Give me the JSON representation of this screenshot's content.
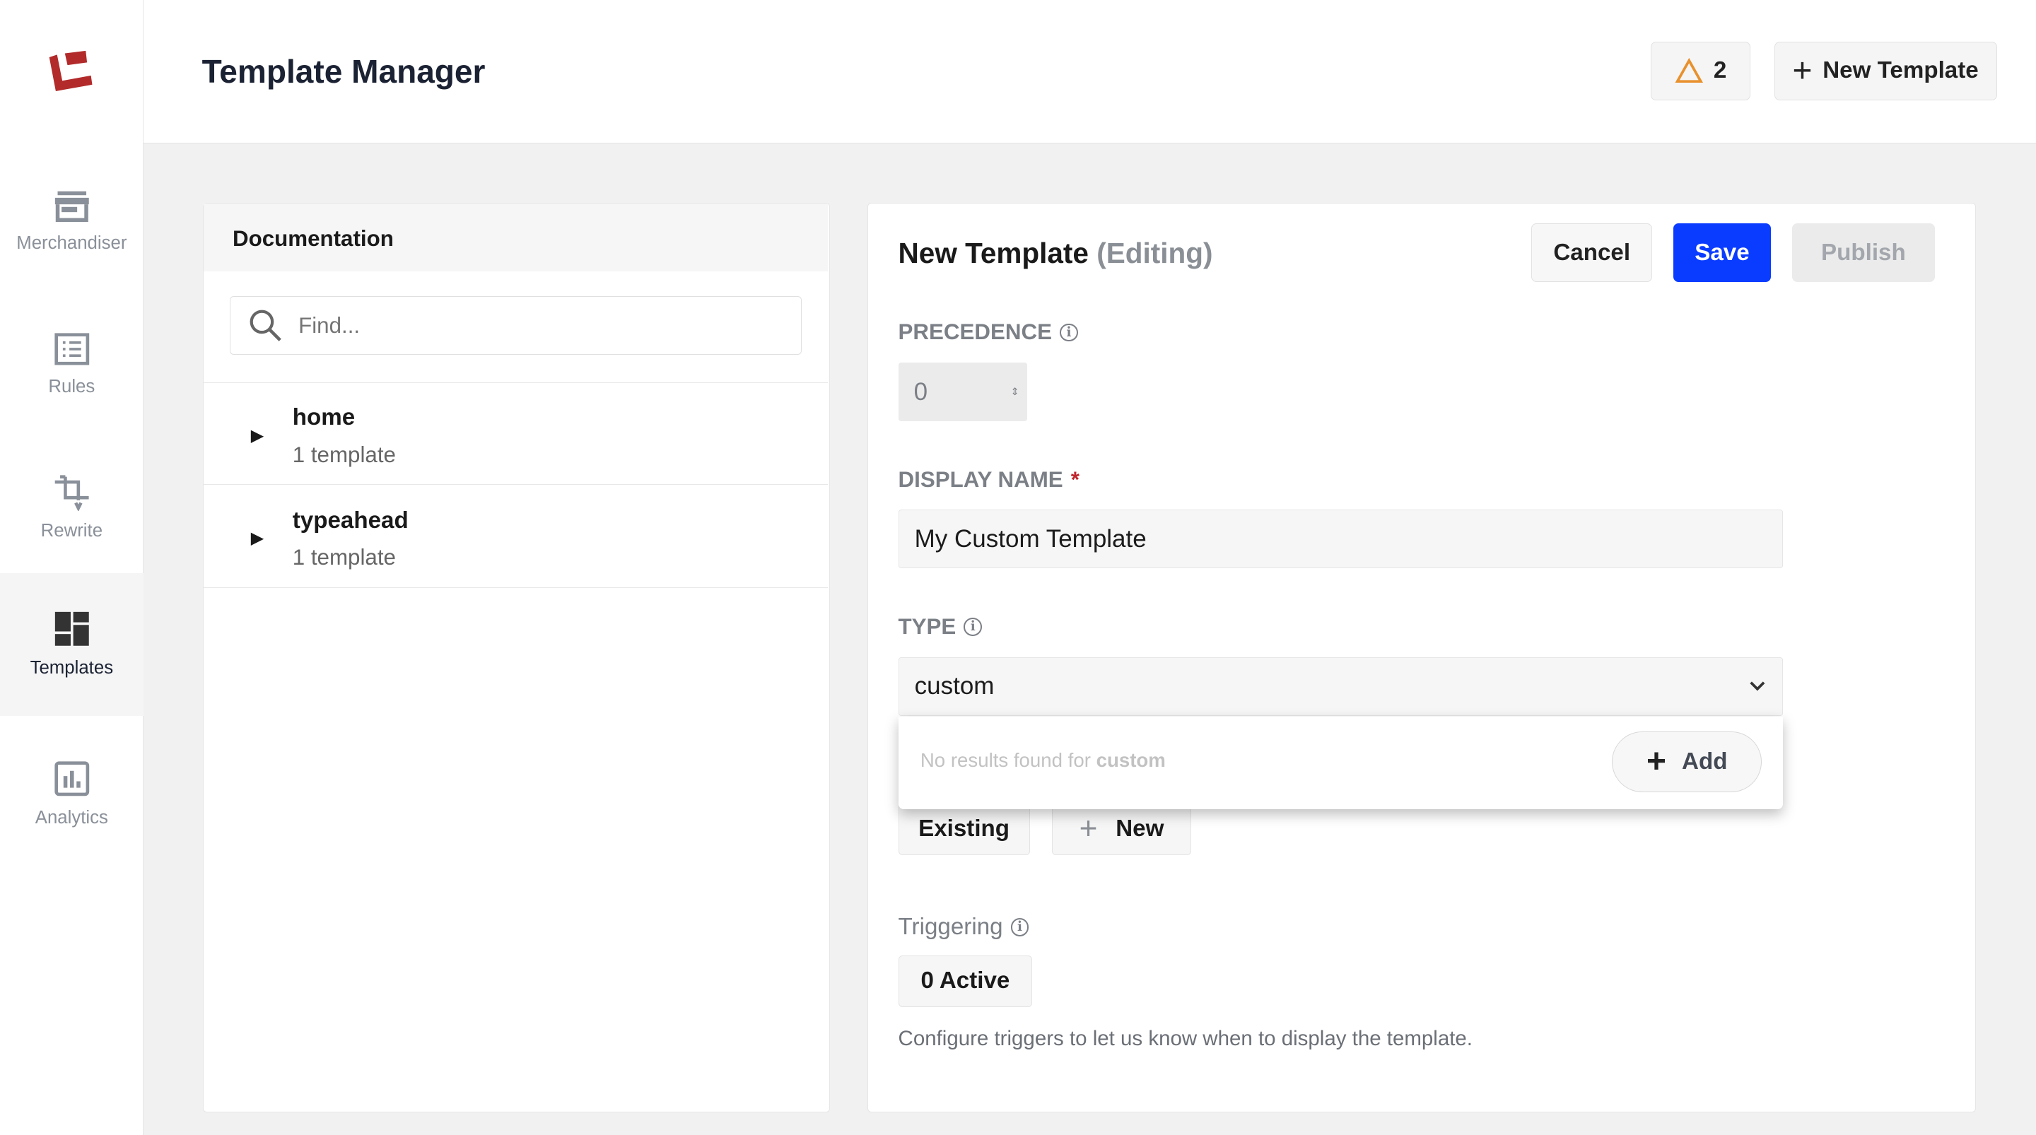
{
  "sidebar": {
    "items": [
      {
        "label": "Merchandiser",
        "icon": "storefront-icon"
      },
      {
        "label": "Rules",
        "icon": "list-icon"
      },
      {
        "label": "Rewrite",
        "icon": "rewrite-icon"
      },
      {
        "label": "Templates",
        "icon": "dashboard-icon",
        "active": true
      },
      {
        "label": "Analytics",
        "icon": "bar-chart-icon"
      }
    ]
  },
  "header": {
    "title": "Template Manager",
    "warnings_count": "2",
    "new_template_label": "New Template"
  },
  "documentation": {
    "title": "Documentation",
    "search_placeholder": "Find...",
    "items": [
      {
        "name": "home",
        "count": "1 template"
      },
      {
        "name": "typeahead",
        "count": "1 template"
      }
    ]
  },
  "editor": {
    "title": "New Template",
    "status": "(Editing)",
    "cancel": "Cancel",
    "save": "Save",
    "publish": "Publish",
    "precedence_label": "PRECEDENCE",
    "precedence_value": "0",
    "display_name_label": "DISPLAY NAME",
    "required_mark": "*",
    "display_name_value": "My Custom Template",
    "type_label": "TYPE",
    "type_value": "custom",
    "dropdown": {
      "no_results": "No results found for",
      "query": "custom",
      "add": "Add"
    },
    "existing": "Existing",
    "new": "New",
    "triggering_label": "Triggering",
    "active_count": "0 Active",
    "help": "Configure triggers to let us know when to display the template."
  },
  "colors": {
    "accent": "#0a3cff",
    "brand": "#b22a2a",
    "warning": "#e8912d"
  }
}
